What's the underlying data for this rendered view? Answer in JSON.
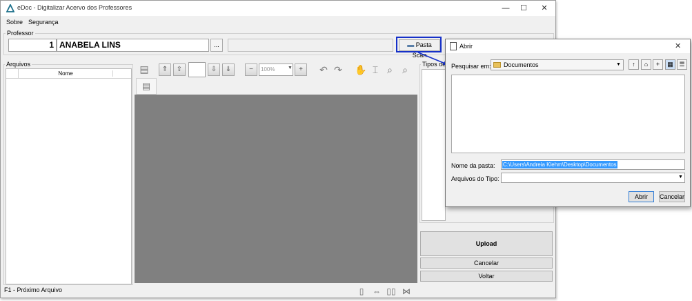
{
  "window": {
    "title": "eDoc - Digitalizar Acervo dos Professores",
    "minimize": "—",
    "maximize": "☐",
    "close": "✕"
  },
  "menu": {
    "items": [
      "Sobre",
      "Segurança"
    ]
  },
  "professor": {
    "group_label": "Professor",
    "id": "1",
    "name": "ANABELA LINS",
    "browse_label": "...",
    "pasta_scan_label": "Pasta Scan"
  },
  "arquivos": {
    "group_label": "Arquivos",
    "column_nome": "Nome"
  },
  "viewer": {
    "zoom_value": "100%"
  },
  "tipos": {
    "group_label": "Tipos de"
  },
  "actions": {
    "upload": "Upload",
    "cancelar": "Cancelar",
    "voltar": "Voltar"
  },
  "status": {
    "hint": "F1 - Próximo Arquivo"
  },
  "dialog": {
    "title": "Abrir",
    "look_in_label": "Pesquisar em:",
    "look_in_value": "Documentos",
    "folder_name_label": "Nome da pasta:",
    "folder_name_value": "C:\\Users\\Andreia Klehm\\Desktop\\Documentos",
    "file_type_label": "Arquivos do Tipo:",
    "file_type_value": "",
    "open_button": "Abrir",
    "cancel_button": "Cancelar",
    "close": "✕"
  },
  "colors": {
    "viewer_background": "#808080",
    "highlight": "#1530c8",
    "selection": "#3399ff",
    "folder_icon": "#e8c15a"
  }
}
